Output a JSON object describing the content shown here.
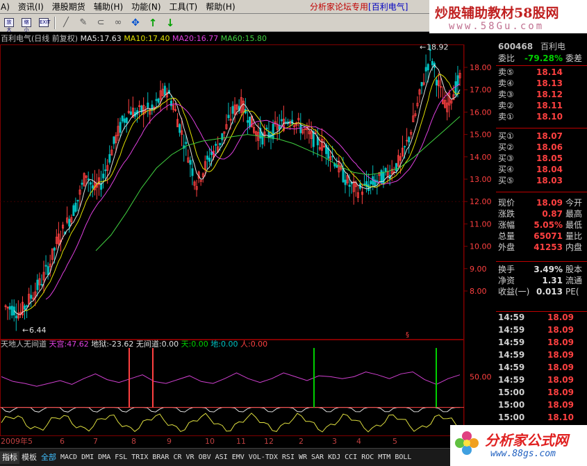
{
  "menu": {
    "items": [
      "A)",
      "资讯(I)",
      "港股期货",
      "辅助(H)",
      "功能(N)",
      "工具(T)",
      "帮助(H)"
    ],
    "forum_prefix": "分析家论坛专用",
    "forum_stock": "[百利电气]"
  },
  "toolbar": {
    "buttons": [
      "zoom-in",
      "zoom-out",
      "exit",
      "line-draw",
      "pen",
      "magnet",
      "link",
      "move",
      "up",
      "down"
    ],
    "box_labels": [
      "放大",
      "缩小",
      "EXIT"
    ]
  },
  "banner": {
    "line1": "炒股辅助教材58股网",
    "line2": "www.58Gu.com"
  },
  "chart_header": {
    "title": "百利电气(日线 前复权)",
    "ma5": "MA5:17.63",
    "ma10": "MA10:17.40",
    "ma20": "MA20:16.77",
    "ma60": "MA60:15.80"
  },
  "indicator_header": {
    "name": "天地人无间道",
    "tian": "天宫:47.62",
    "diyu": "地狱:-23.62",
    "wu": "无间道:0.00",
    "t2": "天:0.00",
    "d2": "地:0.00",
    "ren": "人:0.00"
  },
  "chart_data": {
    "type": "candlestick",
    "title": "百利电气(日线 前复权)",
    "ylabels": [
      "18.00",
      "17.00",
      "16.00",
      "15.00",
      "14.00",
      "13.00",
      "12.00",
      "11.00",
      "10.00",
      "9.00",
      "8.00"
    ],
    "ylim": [
      6.44,
      18.92
    ],
    "high_label": "18.92",
    "low_label": "6.44",
    "x_months": [
      "2009年",
      "5",
      "6",
      "7",
      "8",
      "9",
      "10",
      "11",
      "12",
      "2",
      "3",
      "4",
      "5"
    ],
    "close_path": [
      7.3,
      7.2,
      7.0,
      7.5,
      8.0,
      8.5,
      9.2,
      10.2,
      10.8,
      11.4,
      12.2,
      13.3,
      12.5,
      12.8,
      13.8,
      14.8,
      15.6,
      16.1,
      15.9,
      16.2,
      16.0,
      16.6,
      17.0,
      16.2,
      15.1,
      14.0,
      12.8,
      13.4,
      14.1,
      14.5,
      15.2,
      16.0,
      16.4,
      15.9,
      15.2,
      14.9,
      15.0,
      15.3,
      15.5,
      15.8,
      15.4,
      15.1,
      14.8,
      14.6,
      14.3,
      13.8,
      13.2,
      12.7,
      12.5,
      12.6,
      12.8,
      13.0,
      13.2,
      13.5,
      13.9,
      14.8,
      16.0,
      17.4,
      18.6,
      17.3,
      16.2,
      16.8,
      17.5
    ],
    "ma60_path": [
      9.8,
      10.5,
      11.5,
      12.6,
      13.5,
      14.1,
      14.5,
      14.7,
      14.8,
      14.9,
      15.0,
      14.9,
      14.8,
      14.6,
      14.3,
      14.0,
      13.6,
      13.3,
      13.2,
      13.3,
      13.5,
      14.0,
      14.6,
      15.2,
      15.8
    ],
    "ind_ylabel": "50.00",
    "ind_line": [
      0.62,
      0.57,
      0.55,
      0.52,
      0.55,
      0.58,
      0.54,
      0.6,
      0.65,
      0.59,
      0.56,
      0.6,
      0.64,
      0.57,
      0.55,
      0.59,
      0.63,
      0.57,
      0.55,
      0.6,
      0.66,
      0.6,
      0.56,
      0.6,
      0.66,
      0.62,
      0.58,
      0.63,
      0.62,
      0.6,
      0.62,
      0.67,
      0.64,
      0.6,
      0.65,
      0.67,
      0.59,
      0.54,
      0.6,
      0.64
    ]
  },
  "panel": {
    "code": "600468",
    "name": "百利电",
    "rows": [
      {
        "label": "委比",
        "value": "-79.28%",
        "extra": "委差",
        "green": true
      },
      {
        "label": "卖⑤",
        "value": "18.14",
        "extra": ""
      },
      {
        "label": "卖④",
        "value": "18.13",
        "extra": ""
      },
      {
        "label": "卖③",
        "value": "18.12",
        "extra": ""
      },
      {
        "label": "卖②",
        "value": "18.11",
        "extra": ""
      },
      {
        "label": "卖①",
        "value": "18.10",
        "extra": ""
      },
      {
        "label": "买①",
        "value": "18.07",
        "extra": ""
      },
      {
        "label": "买②",
        "value": "18.06",
        "extra": ""
      },
      {
        "label": "买③",
        "value": "18.05",
        "extra": ""
      },
      {
        "label": "买④",
        "value": "18.04",
        "extra": ""
      },
      {
        "label": "买⑤",
        "value": "18.03",
        "extra": ""
      },
      {
        "label": "现价",
        "value": "18.09",
        "extra": "今开"
      },
      {
        "label": "涨跌",
        "value": "0.87",
        "extra": "最高"
      },
      {
        "label": "涨幅",
        "value": "5.05%",
        "extra": "最低"
      },
      {
        "label": "总量",
        "value": "65071",
        "extra": "量比"
      },
      {
        "label": "外盘",
        "value": "41253",
        "extra": "内盘"
      },
      {
        "label": "换手",
        "value": "3.49%",
        "extra": "股本",
        "white": true
      },
      {
        "label": "净资",
        "value": "1.31",
        "extra": "流通",
        "white": true
      },
      {
        "label": "收益(一)",
        "value": "0.013",
        "extra": "PE(",
        "white": true
      }
    ],
    "ticks": [
      {
        "time": "14:59",
        "price": "18.09"
      },
      {
        "time": "14:59",
        "price": "18.09"
      },
      {
        "time": "14:59",
        "price": "18.09"
      },
      {
        "time": "14:59",
        "price": "18.09"
      },
      {
        "time": "14:59",
        "price": "18.09"
      },
      {
        "time": "14:59",
        "price": "18.09"
      },
      {
        "time": "15:00",
        "price": "18.09"
      },
      {
        "time": "15:00",
        "price": "18.09"
      },
      {
        "time": "15:00",
        "price": "18.10"
      }
    ]
  },
  "tabs": [
    "指标",
    "模板",
    "全部",
    "MACD",
    "DMI",
    "DMA",
    "FSL",
    "TRIX",
    "BRAR",
    "CR",
    "VR",
    "OBV",
    "ASI",
    "EMV",
    "VOL-TDX",
    "RSI",
    "WR",
    "SAR",
    "KDJ",
    "CCI",
    "ROC",
    "MTM",
    "BOLL"
  ],
  "logo": {
    "line1": "分析家公式网",
    "line2": "www.88gs.com"
  },
  "colors": {
    "up": "#ff4040",
    "down": "#00c0c0",
    "ma5": "#e0e0e0",
    "ma10": "#e0e000",
    "ma20": "#e040e0",
    "ma60": "#40d040",
    "grid": "#800000"
  }
}
